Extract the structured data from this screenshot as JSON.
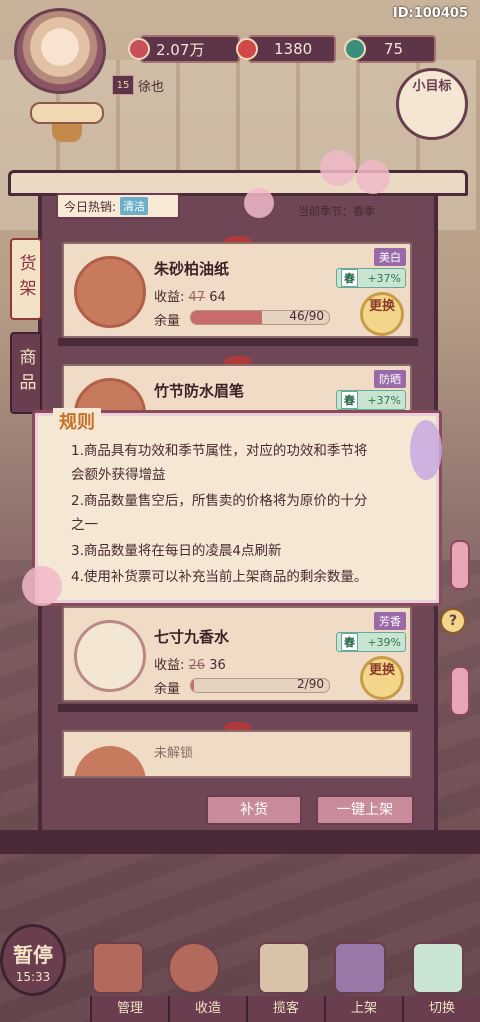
{
  "player": {
    "id": "ID:100405",
    "level": "15",
    "name": "徐也"
  },
  "resources": [
    {
      "name": "reputation",
      "value": "2.07万"
    },
    {
      "name": "coins",
      "value": "1380"
    },
    {
      "name": "gems",
      "value": "75"
    }
  ],
  "goal_label": "小目标",
  "shop": {
    "hot_label": "今日热销:",
    "hot_tag": "清洁",
    "season_label": "当前季节：春季",
    "tabs": [
      "货架",
      "商品"
    ]
  },
  "items": [
    {
      "name": "朱砂柏油纸",
      "revenue_label": "收益:",
      "old_price": "47",
      "price": "64",
      "stock_label": "余量",
      "stock": "46/90",
      "stock_fraction": 0.511,
      "effect": "美白",
      "season": "春",
      "bonus": "+37%",
      "swap": "更换"
    },
    {
      "name": "竹节防水眉笔",
      "effect": "防晒",
      "season": "春",
      "bonus": "+37%"
    },
    {
      "name": "七寸九香水",
      "revenue_label": "收益:",
      "old_price": "26",
      "price": "36",
      "stock_label": "余量",
      "stock": "2/90",
      "stock_fraction": 0.022,
      "effect": "芳香",
      "season": "春",
      "bonus": "+39%",
      "swap": "更换"
    }
  ],
  "locked_label": "未解锁",
  "actions": {
    "restock": "补货",
    "one_click": "一键上架"
  },
  "rules": {
    "title": "规则",
    "lines": [
      "1.商品具有功效和季节属性，对应的功效和季节将",
      "会额外获得增益",
      "2.商品数量售空后，所售卖的价格将为原价的十分",
      "之一",
      "3.商品数量将在每日的凌晨4点刷新",
      "4.使用补货票可以补充当前上架商品的剩余数量。"
    ]
  },
  "pause": {
    "label": "暂停",
    "clock": "15:33"
  },
  "help": "?",
  "nav": [
    "管理",
    "收造",
    "揽客",
    "上架",
    "切换"
  ]
}
